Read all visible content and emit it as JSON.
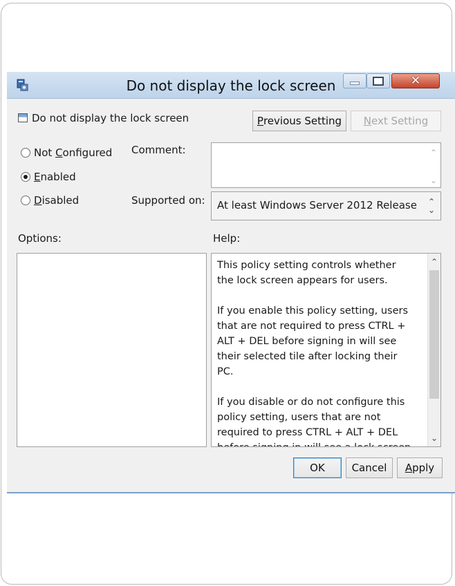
{
  "window": {
    "title": "Do not display the lock screen",
    "controls": {
      "minimize": "—",
      "maximize": "□",
      "close": "✕"
    }
  },
  "header": {
    "policy_name": "Do not display the lock screen",
    "previous_button": {
      "underline": "P",
      "rest": "revious Setting"
    },
    "next_button": {
      "underline": "N",
      "rest": "ext Setting"
    }
  },
  "state": {
    "options": [
      {
        "before": "Not ",
        "underline": "C",
        "after": "onfigured",
        "checked": false
      },
      {
        "before": "",
        "underline": "E",
        "after": "nabled",
        "checked": true
      },
      {
        "before": "",
        "underline": "D",
        "after": "isabled",
        "checked": false
      }
    ],
    "comment_label": "Comment:",
    "comment_value": "",
    "supported_label": "Supported on:",
    "supported_value": "At least Windows Server 2012 Release"
  },
  "options_label": "Options:",
  "help_label": "Help:",
  "help_paragraphs": [
    "This policy setting controls whether the lock screen appears for users.",
    "If you enable this policy setting, users that are not required to press CTRL + ALT + DEL before signing in will see their selected tile after  locking their PC.",
    "If you disable or do not configure this policy setting, users that are not required to press CTRL + ALT + DEL before signing in will see a lock screen after"
  ],
  "footer": {
    "ok": "OK",
    "cancel": "Cancel",
    "apply": {
      "underline": "A",
      "rest": "pply"
    }
  }
}
